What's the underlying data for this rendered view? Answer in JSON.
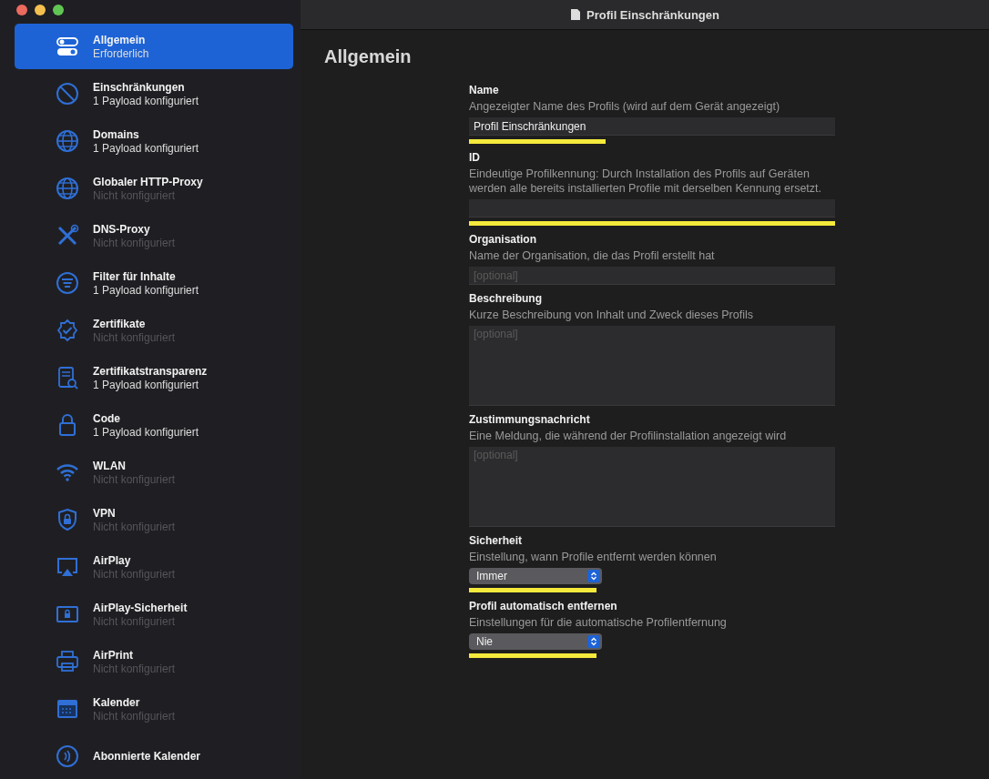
{
  "window": {
    "title": "Profil Einschränkungen"
  },
  "sidebar": {
    "items": [
      {
        "title": "Allgemein",
        "subtitle": "Erforderlich",
        "selected": true
      },
      {
        "title": "Einschränkungen",
        "subtitle": "1 Payload konfiguriert",
        "configured": true,
        "selected": false
      },
      {
        "title": "Domains",
        "subtitle": "1 Payload konfiguriert",
        "configured": true,
        "selected": false
      },
      {
        "title": "Globaler HTTP-Proxy",
        "subtitle": "Nicht konfiguriert",
        "configured": false,
        "selected": false
      },
      {
        "title": "DNS-Proxy",
        "subtitle": "Nicht konfiguriert",
        "configured": false,
        "selected": false
      },
      {
        "title": "Filter für Inhalte",
        "subtitle": "1 Payload konfiguriert",
        "configured": true,
        "selected": false
      },
      {
        "title": "Zertifikate",
        "subtitle": "Nicht konfiguriert",
        "configured": false,
        "selected": false
      },
      {
        "title": "Zertifikatstransparenz",
        "subtitle": "1 Payload konfiguriert",
        "configured": true,
        "selected": false
      },
      {
        "title": "Code",
        "subtitle": "1 Payload konfiguriert",
        "configured": true,
        "selected": false
      },
      {
        "title": "WLAN",
        "subtitle": "Nicht konfiguriert",
        "configured": false,
        "selected": false
      },
      {
        "title": "VPN",
        "subtitle": "Nicht konfiguriert",
        "configured": false,
        "selected": false
      },
      {
        "title": "AirPlay",
        "subtitle": "Nicht konfiguriert",
        "configured": false,
        "selected": false
      },
      {
        "title": "AirPlay-Sicherheit",
        "subtitle": "Nicht konfiguriert",
        "configured": false,
        "selected": false
      },
      {
        "title": "AirPrint",
        "subtitle": "Nicht konfiguriert",
        "configured": false,
        "selected": false
      },
      {
        "title": "Kalender",
        "subtitle": "Nicht konfiguriert",
        "configured": false,
        "selected": false
      },
      {
        "title": "Abonnierte Kalender",
        "selected": false
      }
    ]
  },
  "main": {
    "heading": "Allgemein",
    "fields": [
      {
        "kind": "input",
        "label": "Name",
        "description": "Angezeigter Name des Profils (wird auf dem Gerät angezeigt)",
        "value": "Profil Einschränkungen",
        "highlighted": true
      },
      {
        "kind": "input",
        "label": "ID",
        "description": "Eindeutige Profilkennung: Durch Installation des Profils auf Geräten werden alle bereits installierten Profile mit derselben Kennung ersetzt.",
        "highlighted": true
      },
      {
        "kind": "input",
        "label": "Organisation",
        "description": "Name der Organisation, die das Profil erstellt hat",
        "placeholder": "[optional]",
        "highlighted": false
      },
      {
        "kind": "textarea",
        "label": "Beschreibung",
        "description": "Kurze Beschreibung von Inhalt und Zweck dieses Profils",
        "placeholder": "[optional]",
        "highlighted": false
      },
      {
        "kind": "textarea",
        "label": "Zustimmungsnachricht",
        "description": "Eine Meldung, die während der Profilinstallation angezeigt wird",
        "placeholder": "[optional]",
        "highlighted": false
      },
      {
        "kind": "select",
        "label": "Sicherheit",
        "description": "Einstellung, wann Profile entfernt werden können",
        "value": "Immer",
        "highlighted": true
      },
      {
        "kind": "select",
        "label": "Profil automatisch entfernen",
        "description": "Einstellungen für die automatische Profilentfernung",
        "value": "Nie",
        "highlighted": true
      }
    ]
  }
}
